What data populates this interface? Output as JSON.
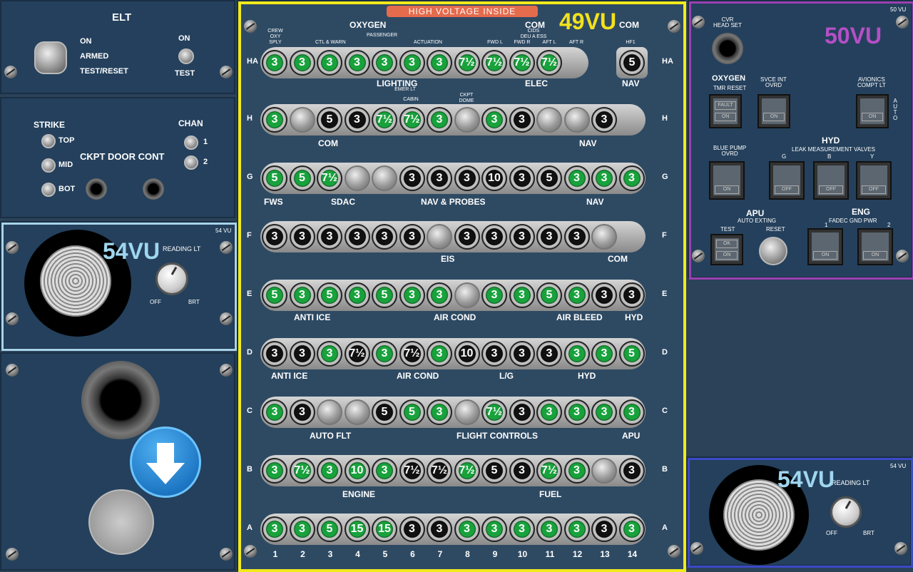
{
  "elt": {
    "title": "ELT",
    "on": "ON",
    "armed": "ARMED",
    "test_reset": "TEST/RESET",
    "sw_on": "ON",
    "test": "TEST"
  },
  "door": {
    "strike": "STRIKE",
    "chan": "CHAN",
    "top": "TOP",
    "mid": "MID",
    "bot": "BOT",
    "chan1": "1",
    "chan2": "2",
    "title": "CKPT DOOR CONT"
  },
  "reading_left": {
    "vu_tag": "54 VU",
    "overlay": "54VU",
    "label": "READING LT",
    "off": "OFF",
    "brt": "BRT"
  },
  "reading_right": {
    "vu_tag": "54 VU",
    "overlay": "54VU",
    "label": "READING LT",
    "off": "OFF",
    "brt": "BRT"
  },
  "panel49": {
    "banner": "HIGH VOLTAGE INSIDE",
    "overlay": "49VU",
    "com_tag": "COM"
  },
  "panel50": {
    "vu_tag": "50 VU",
    "overlay": "50VU",
    "cvr": "CVR\nHEAD SET",
    "oxygen": "OXYGEN",
    "tmr": "TMR RESET",
    "fault": "FAULT",
    "on": "ON",
    "svce": "SVCE INT\nOVRD",
    "avionics": "AVIONICS\nCOMPT LT",
    "auto": "A\nU\nT\nO",
    "hyd": "HYD",
    "blue_pump": "BLUE PUMP\nOVRD",
    "leak": "LEAK MEASUREMENT VALVES",
    "g": "G",
    "b": "B",
    "y": "Y",
    "off": "OFF",
    "apu": "APU",
    "auto_exting": "AUTO EXTING",
    "test": "TEST",
    "reset": "RESET",
    "ok": "OK",
    "eng": "ENG",
    "fadec": "FADEC GND PWR",
    "one": "1",
    "two": "2"
  },
  "rows": [
    {
      "letter": "HA",
      "cells": [
        [
          "green",
          "3"
        ],
        [
          "green",
          "3"
        ],
        [
          "green",
          "3"
        ],
        [
          "green",
          "3"
        ],
        [
          "green",
          "3"
        ],
        [
          "green",
          "3"
        ],
        [
          "green",
          "3"
        ],
        [
          "green",
          "7½"
        ],
        [
          "green",
          "7½"
        ],
        [
          "green",
          "7½"
        ],
        [
          "green",
          "7½"
        ]
      ],
      "extra": [
        "black",
        "5"
      ]
    },
    {
      "letter": "H",
      "cells": [
        [
          "green",
          "3"
        ],
        [
          "blank",
          ""
        ],
        [
          "black",
          "5"
        ],
        [
          "black",
          "3"
        ],
        [
          "green",
          "7½"
        ],
        [
          "green",
          "7½"
        ],
        [
          "green",
          "3"
        ],
        [
          "blank",
          ""
        ],
        [
          "green",
          "3"
        ],
        [
          "black",
          "3"
        ],
        [
          "blank",
          ""
        ],
        [
          "blank",
          ""
        ],
        [
          "black",
          "3"
        ]
      ]
    },
    {
      "letter": "G",
      "cells": [
        [
          "green",
          "5"
        ],
        [
          "green",
          "5"
        ],
        [
          "green",
          "7½"
        ],
        [
          "blank",
          ""
        ],
        [
          "blank",
          ""
        ],
        [
          "black",
          "3"
        ],
        [
          "black",
          "3"
        ],
        [
          "black",
          "3"
        ],
        [
          "black",
          "10"
        ],
        [
          "black",
          "3"
        ],
        [
          "black",
          "5"
        ],
        [
          "green",
          "3"
        ],
        [
          "green",
          "3"
        ],
        [
          "green",
          "3"
        ]
      ]
    },
    {
      "letter": "F",
      "cells": [
        [
          "black",
          "3"
        ],
        [
          "black",
          "3"
        ],
        [
          "black",
          "3"
        ],
        [
          "black",
          "3"
        ],
        [
          "black",
          "3"
        ],
        [
          "black",
          "3"
        ],
        [
          "blank",
          ""
        ],
        [
          "black",
          "3"
        ],
        [
          "black",
          "3"
        ],
        [
          "black",
          "3"
        ],
        [
          "black",
          "3"
        ],
        [
          "black",
          "3"
        ],
        [
          "blank",
          ""
        ]
      ]
    },
    {
      "letter": "E",
      "cells": [
        [
          "green",
          "5"
        ],
        [
          "green",
          "3"
        ],
        [
          "green",
          "5"
        ],
        [
          "green",
          "3"
        ],
        [
          "green",
          "5"
        ],
        [
          "green",
          "3"
        ],
        [
          "green",
          "3"
        ],
        [
          "blank",
          ""
        ],
        [
          "green",
          "3"
        ],
        [
          "green",
          "3"
        ],
        [
          "green",
          "5"
        ],
        [
          "green",
          "3"
        ],
        [
          "black",
          "3"
        ],
        [
          "black",
          "3"
        ]
      ]
    },
    {
      "letter": "D",
      "cells": [
        [
          "black",
          "3"
        ],
        [
          "black",
          "3"
        ],
        [
          "green",
          "3"
        ],
        [
          "black",
          "7½"
        ],
        [
          "green",
          "3"
        ],
        [
          "black",
          "7½"
        ],
        [
          "green",
          "3"
        ],
        [
          "black",
          "10"
        ],
        [
          "black",
          "3"
        ],
        [
          "black",
          "3"
        ],
        [
          "black",
          "3"
        ],
        [
          "green",
          "3"
        ],
        [
          "green",
          "3"
        ],
        [
          "green",
          "5"
        ]
      ]
    },
    {
      "letter": "C",
      "cells": [
        [
          "green",
          "3"
        ],
        [
          "black",
          "3"
        ],
        [
          "blank",
          ""
        ],
        [
          "blank",
          ""
        ],
        [
          "black",
          "5"
        ],
        [
          "green",
          "5"
        ],
        [
          "green",
          "3"
        ],
        [
          "blank",
          ""
        ],
        [
          "green",
          "7½"
        ],
        [
          "black",
          "3"
        ],
        [
          "green",
          "3"
        ],
        [
          "green",
          "3"
        ],
        [
          "green",
          "3"
        ],
        [
          "green",
          "3"
        ]
      ]
    },
    {
      "letter": "B",
      "cells": [
        [
          "green",
          "3"
        ],
        [
          "green",
          "7½"
        ],
        [
          "green",
          "3"
        ],
        [
          "green",
          "10"
        ],
        [
          "green",
          "3"
        ],
        [
          "black",
          "7½"
        ],
        [
          "black",
          "7½"
        ],
        [
          "green",
          "7½"
        ],
        [
          "black",
          "5"
        ],
        [
          "black",
          "3"
        ],
        [
          "green",
          "7½"
        ],
        [
          "green",
          "3"
        ],
        [
          "blank",
          ""
        ],
        [
          "black",
          "3"
        ]
      ]
    },
    {
      "letter": "A",
      "cells": [
        [
          "green",
          "3"
        ],
        [
          "green",
          "3"
        ],
        [
          "green",
          "5"
        ],
        [
          "green",
          "15"
        ],
        [
          "green",
          "15"
        ],
        [
          "black",
          "3"
        ],
        [
          "black",
          "3"
        ],
        [
          "green",
          "3"
        ],
        [
          "green",
          "3"
        ],
        [
          "green",
          "3"
        ],
        [
          "green",
          "3"
        ],
        [
          "green",
          "3"
        ],
        [
          "black",
          "3"
        ],
        [
          "green",
          "3"
        ]
      ]
    }
  ],
  "groups": {
    "oxygen": "OXYGEN",
    "com": "COM",
    "passenger": "PASSENGER",
    "cids": "CIDS",
    "deu_a_ess": "DEU A ESS",
    "ctl_warn": "CTL & WARN",
    "actuation": "ACTUATION",
    "crew_oxy": "CREW\nOXY\nSPLY",
    "fwd_l": "FWD L",
    "fwd_r": "FWD R",
    "aft_l": "AFT L",
    "aft_r": "AFT R",
    "hf1": "HF1",
    "lighting": "LIGHTING",
    "elec": "ELEC",
    "nav": "NAV",
    "emer_lt": "EMER LT",
    "cabin": "CABIN",
    "ckpt_dome": "CKPT\nDOME",
    "fws": "FWS",
    "sdac": "SDAC",
    "nav_probes": "NAV & PROBES",
    "eis": "EIS",
    "anti_ice": "ANTI ICE",
    "air_cond": "AIR COND",
    "air_bleed": "AIR BLEED",
    "hyd": "HYD",
    "lg": "L/G",
    "auto_flt": "AUTO FLT",
    "flight_controls": "FLIGHT CONTROLS",
    "apu": "APU",
    "engine": "ENGINE",
    "fuel": "FUEL"
  },
  "columns": [
    "1",
    "2",
    "3",
    "4",
    "5",
    "6",
    "7",
    "8",
    "9",
    "10",
    "11",
    "12",
    "13",
    "14"
  ],
  "nav_arrow_label": "down-arrow"
}
